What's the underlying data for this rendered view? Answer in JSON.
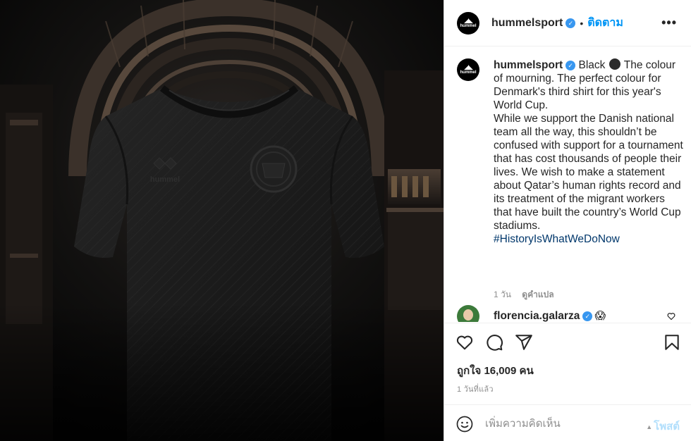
{
  "header": {
    "username": "hummelsport",
    "separator": "•",
    "follow_label": "ติดตาม",
    "more_label": "•••",
    "avatar_logo_text": "hummel"
  },
  "caption": {
    "username": "hummelsport",
    "text_before_dot": "Black",
    "text_after_dot": "The colour of mourning. The perfect colour for Denmark's third shirt for this year's World Cup.",
    "text_paragraph2": "While we support the Danish national team all the way, this shouldn’t be confused with support for a tournament that has cost thousands of people their lives. We wish to make a statement about Qatar’s human rights record and its treatment of the migrant workers that have built the country’s World Cup stadiums.",
    "hashtag": "#HistoryIsWhatWeDoNow",
    "time": "1 วัน",
    "translate_label": "ดูคำแปล"
  },
  "comment": {
    "username": "florencia.galarza",
    "emoji": "😱"
  },
  "post": {
    "likes_text": "ถูกใจ 16,009 คน",
    "time_ago": "1 วันที่แล้ว"
  },
  "add_comment": {
    "placeholder": "เพิ่มความคิดเห็น",
    "post_label": "โพสต์"
  },
  "media": {
    "shirt_logo_text": "hummel"
  },
  "colors": {
    "accent": "#0095f6",
    "verified": "#3897f0",
    "hashtag": "#00376b",
    "muted": "#8e8e8e",
    "post_disabled": "#b2dffc"
  },
  "icons": [
    "verified-badge-icon",
    "more-icon",
    "heart-icon",
    "comment-icon",
    "share-icon",
    "bookmark-icon",
    "emoji-icon",
    "small-heart-icon"
  ]
}
